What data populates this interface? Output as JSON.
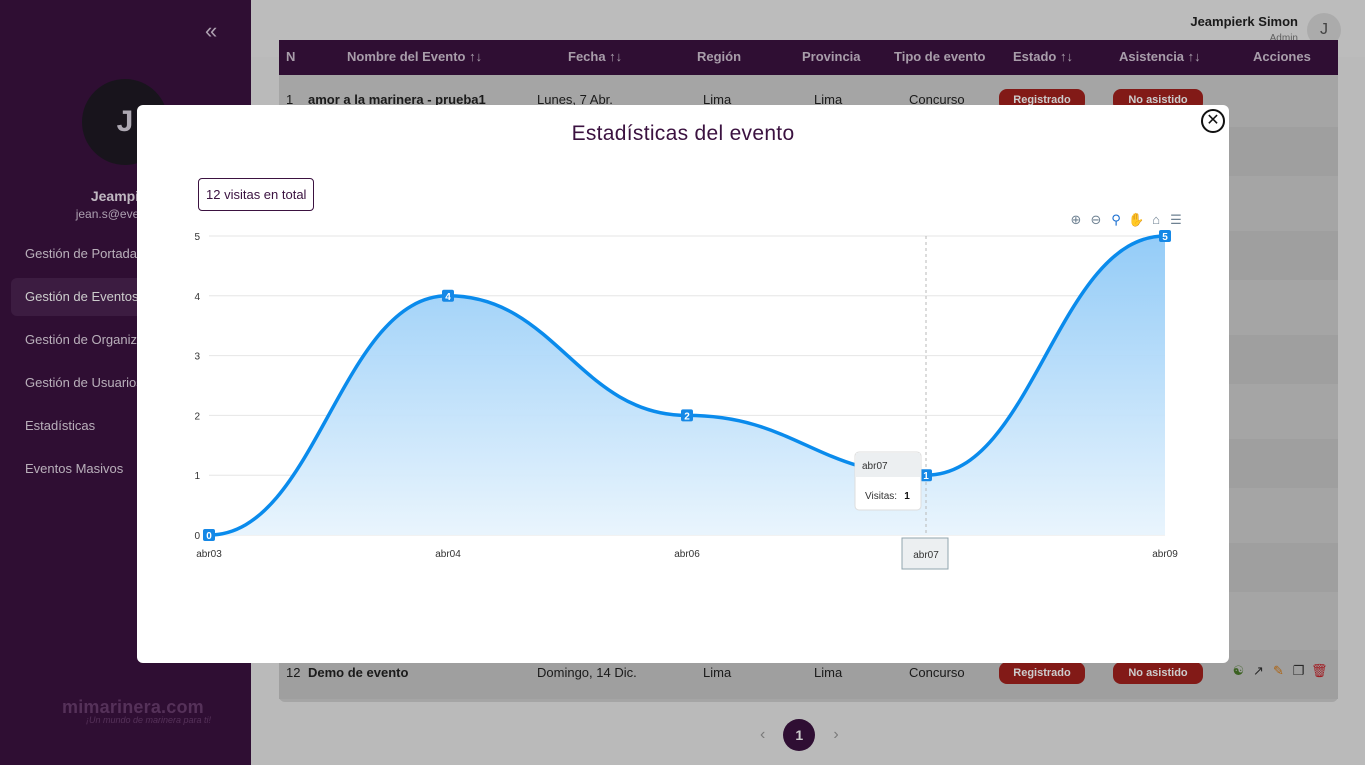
{
  "sidebar": {
    "avatar_letter": "J",
    "user_name": "Jeampierk",
    "user_email": "jean.s@eventosde",
    "nav": [
      {
        "label": "Gestión de Portadas"
      },
      {
        "label": "Gestión de Eventos"
      },
      {
        "label": "Gestión de Organiza"
      },
      {
        "label": "Gestión de Usuarios"
      },
      {
        "label": "Estadísticas"
      },
      {
        "label": "Eventos Masivos"
      }
    ],
    "brand": "mimarinera.com",
    "brand_sub": "¡Un mundo de marinera para ti!",
    "collapse_icon": "chevrons-left-icon"
  },
  "topbar": {
    "user_name": "Jeampierk Simon",
    "role": "Admin",
    "avatar_letter": "J"
  },
  "table": {
    "headers": [
      "N",
      "Nombre del Evento ↑↓",
      "Fecha ↑↓",
      "Región",
      "Provincia",
      "Tipo de evento",
      "Estado ↑↓",
      "Asistencia ↑↓",
      "Acciones"
    ],
    "first_row": {
      "n": "1",
      "name": "amor a la marinera - prueba1",
      "date": "Lunes, 7 Abr.",
      "region": "Lima",
      "province": "Lima",
      "type": "Concurso",
      "status": "Registrado",
      "attendance": "No asistido"
    },
    "last_row": {
      "n": "12",
      "name": "Demo de evento",
      "date": "Domingo, 14 Dic.",
      "region": "Lima",
      "province": "Lima",
      "type": "Concurso",
      "status": "Registrado",
      "attendance": "No asistido"
    }
  },
  "pagination": {
    "current": "1",
    "prev": "‹",
    "next": "›"
  },
  "modal": {
    "title": "Estadísticas del evento",
    "total_visits": "12 visitas en total",
    "close_icon": "close-circle-icon",
    "tools": [
      "zoom-in-icon",
      "zoom-out-icon",
      "zoom-selection-icon",
      "pan-icon",
      "reset-home-icon",
      "menu-icon"
    ]
  },
  "chart_data": {
    "type": "area",
    "categories": [
      "abr03",
      "abr04",
      "abr06",
      "abr07",
      "abr09"
    ],
    "series": [
      {
        "name": "Visitas",
        "values": [
          0,
          4,
          2,
          1,
          5
        ]
      }
    ],
    "ylim": [
      0,
      5
    ],
    "yticks": [
      0,
      1,
      2,
      3,
      4,
      5
    ],
    "grid": true,
    "line_color": "#0a8bec",
    "tooltip": {
      "category": "abr07",
      "label": "Visitas:",
      "value": "1"
    },
    "crosshair_label": "abr07"
  }
}
